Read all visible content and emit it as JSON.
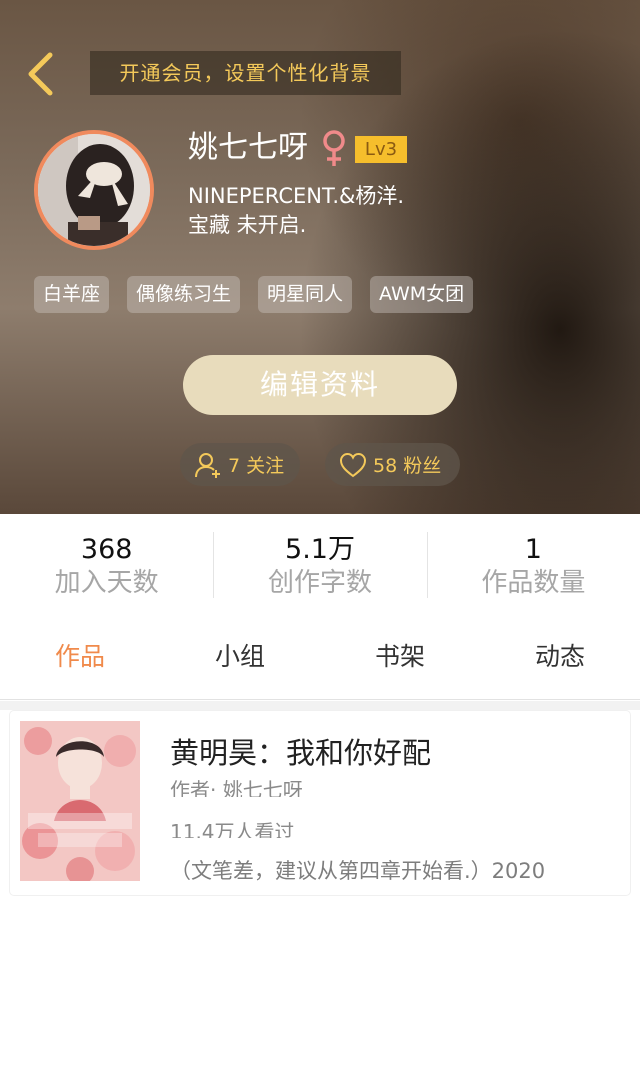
{
  "header": {
    "vip_banner": "开通会员，设置个性化背景",
    "username": "姚七七呀",
    "level": "Lv3",
    "bio": "NINEPERCENT.&杨洋.\n宝藏    未开启.",
    "tags": [
      "白羊座",
      "偶像练习生",
      "明星同人",
      "AWM女团"
    ],
    "edit_button": "编辑资料",
    "following": "7 关注",
    "fans": "58 粉丝",
    "colors": {
      "accent_gold": "#f4c95a",
      "avatar_ring": "#f08a5d",
      "level_badge": "#f6be2c",
      "edit_button": "#e8dcbc"
    }
  },
  "stats": [
    {
      "value": "368",
      "label": "加入天数"
    },
    {
      "value": "5.1万",
      "label": "创作字数"
    },
    {
      "value": "1",
      "label": "作品数量"
    }
  ],
  "tabs": [
    {
      "label": "作品",
      "active": true
    },
    {
      "label": "小组",
      "active": false
    },
    {
      "label": "书架",
      "active": false
    },
    {
      "label": "动态",
      "active": false
    }
  ],
  "work": {
    "title": "黄明昊：我和你好配",
    "author": "作者· 姚七七呀",
    "views": "11.4万人看过",
    "description": "（文笔差，建议从第四章开始看.）2020"
  },
  "icons": {
    "back": "chevron-left-icon",
    "gender": "female-symbol-icon",
    "follow": "user-plus-icon",
    "fans": "heart-icon"
  }
}
